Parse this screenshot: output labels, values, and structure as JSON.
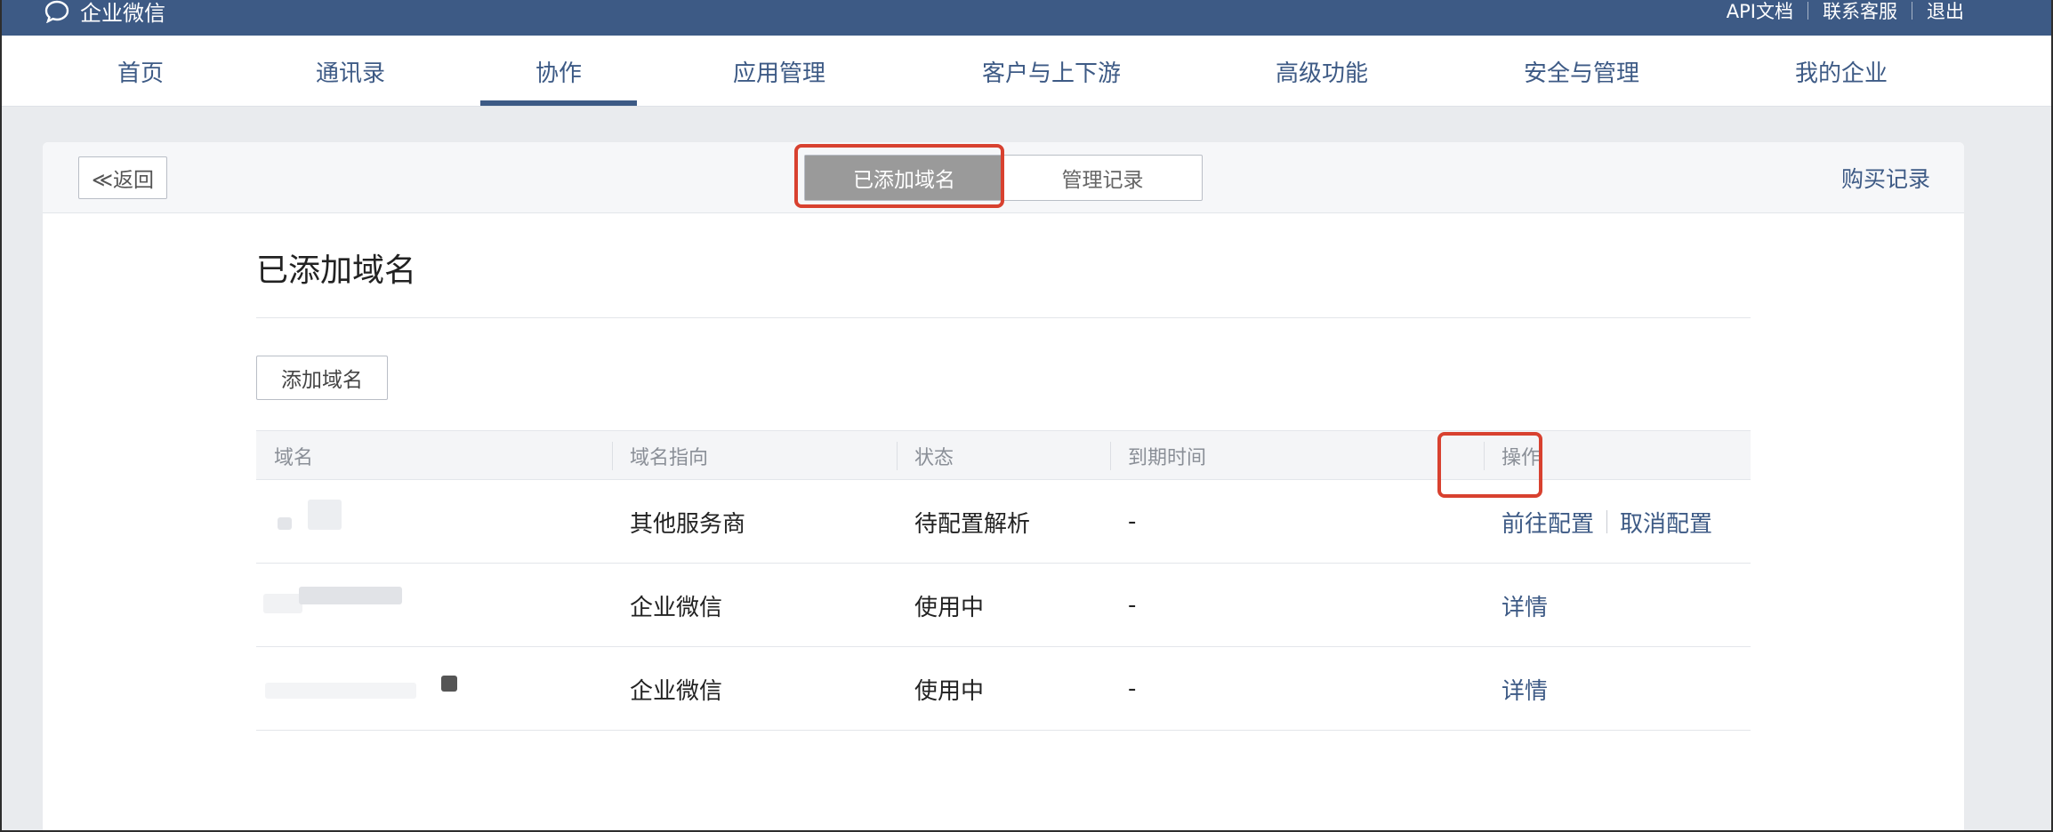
{
  "topbar": {
    "brand": "企业微信",
    "links": [
      "API文档",
      "联系客服",
      "退出"
    ]
  },
  "nav": {
    "items": [
      "首页",
      "通讯录",
      "协作",
      "应用管理",
      "客户与上下游",
      "高级功能",
      "安全与管理",
      "我的企业"
    ],
    "active_index": 2
  },
  "panel": {
    "back_label": "≪返回",
    "tabs": [
      "已添加域名",
      "管理记录"
    ],
    "active_tab": 0,
    "buy_record": "购买记录",
    "title": "已添加域名",
    "add_button": "添加域名",
    "columns": [
      "域名",
      "域名指向",
      "状态",
      "到期时间",
      "操作"
    ],
    "rows": [
      {
        "domain": "",
        "target": "其他服务商",
        "status": "待配置解析",
        "expiry": "-",
        "actions": [
          "前往配置",
          "取消配置"
        ]
      },
      {
        "domain": "",
        "target": "企业微信",
        "status": "使用中",
        "expiry": "-",
        "actions": [
          "详情"
        ]
      },
      {
        "domain": "",
        "target": "企业微信",
        "status": "使用中",
        "expiry": "-",
        "actions": [
          "详情"
        ]
      }
    ]
  },
  "colors": {
    "brand": "#3d5a85",
    "highlight": "#d8412f",
    "tab_active": "#9a9a9a"
  }
}
